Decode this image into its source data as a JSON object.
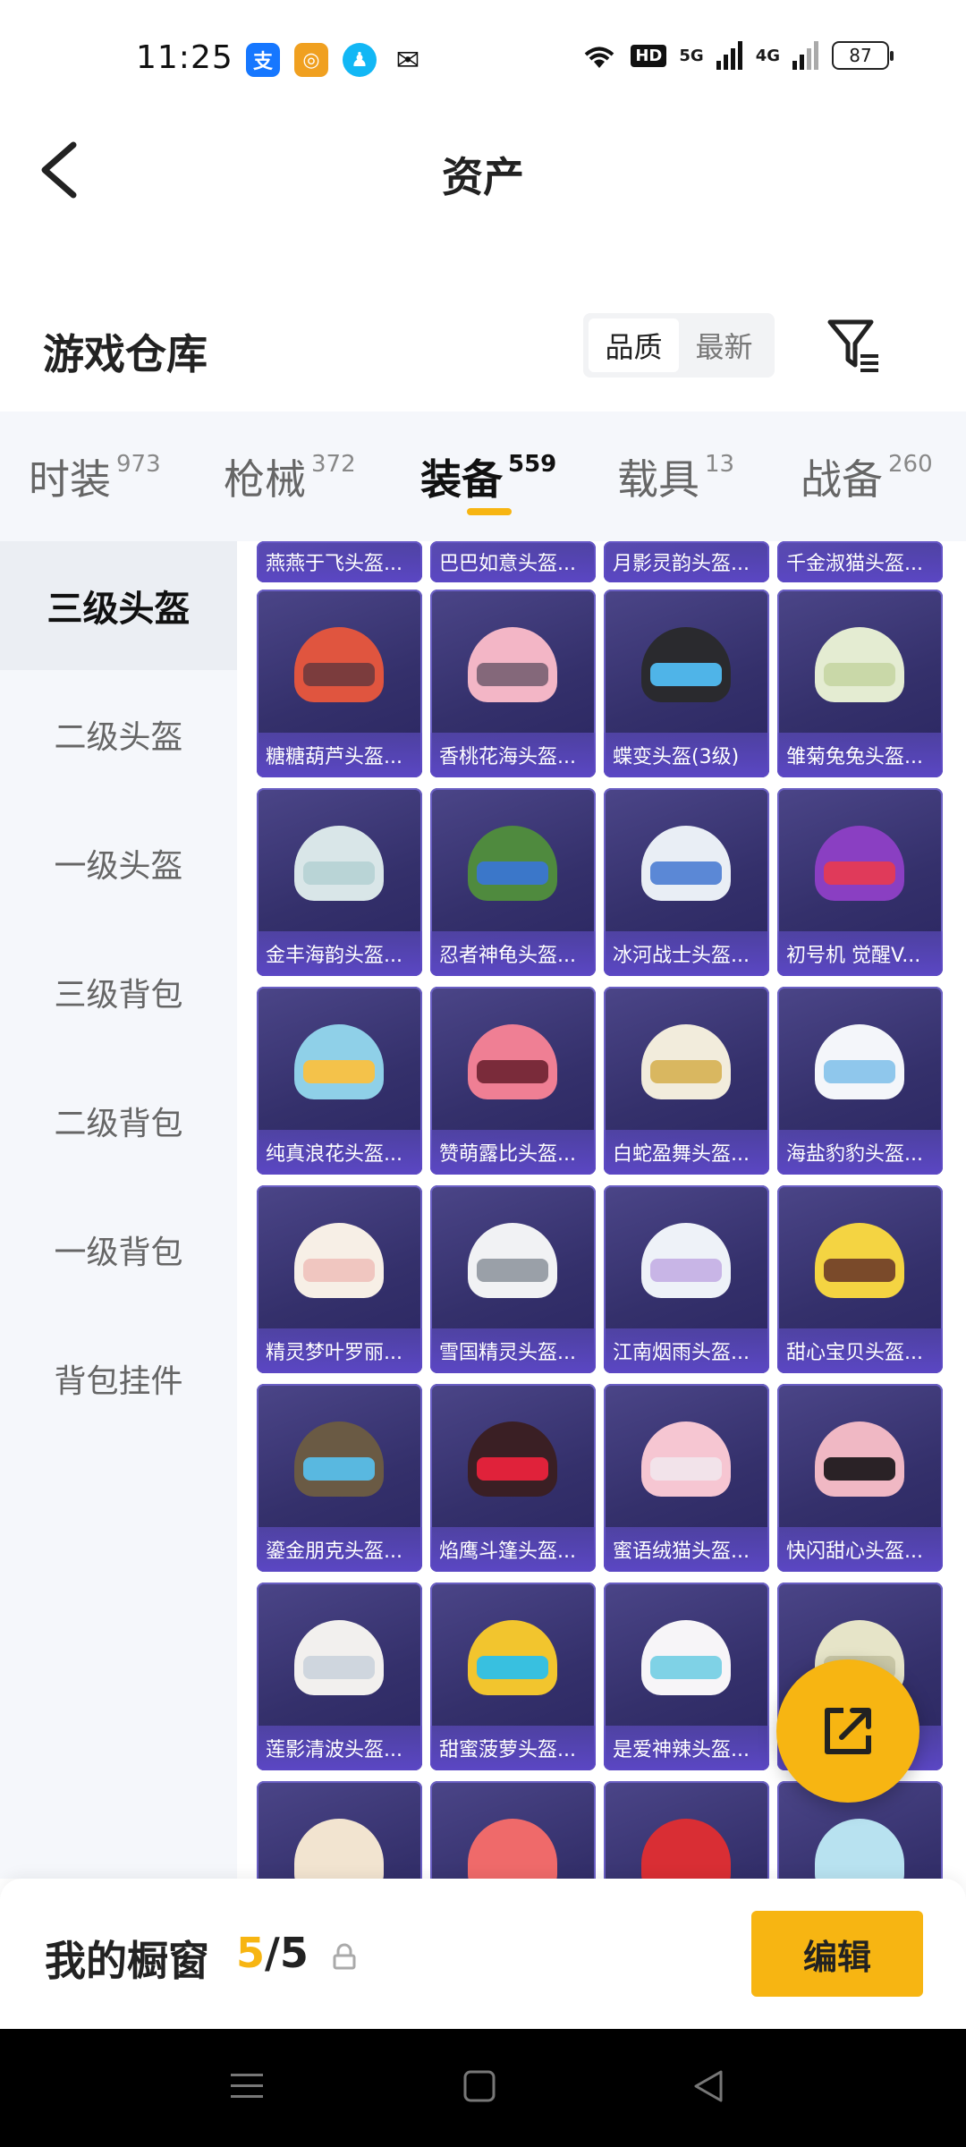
{
  "status": {
    "time": "11:25",
    "battery": "87",
    "net1": "5G",
    "net2": "4G",
    "hd": "HD"
  },
  "header": {
    "title": "资产"
  },
  "warehouse": {
    "title": "游戏仓库",
    "sort_options": [
      "品质",
      "最新"
    ],
    "sort_active": "品质"
  },
  "tabs": [
    {
      "label": "时装",
      "count": "973"
    },
    {
      "label": "枪械",
      "count": "372"
    },
    {
      "label": "装备",
      "count": "559"
    },
    {
      "label": "载具",
      "count": "13"
    },
    {
      "label": "战备",
      "count": "260"
    }
  ],
  "sidebar": [
    "三级头盔",
    "二级头盔",
    "一级头盔",
    "三级背包",
    "二级背包",
    "一级背包",
    "背包挂件"
  ],
  "partial_row": [
    "燕燕于飞头盔...",
    "巴巴如意头盔...",
    "月影灵韵头盔...",
    "千金淑猫头盔..."
  ],
  "items": [
    [
      "糖糖葫芦头盔...",
      "香桃花海头盔...",
      "蝶变头盔(3级)",
      "雏菊兔兔头盔..."
    ],
    [
      "金丰海韵头盔...",
      "忍者神龟头盔...",
      "冰河战士头盔...",
      "初号机 觉醒V..."
    ],
    [
      "纯真浪花头盔...",
      "赞萌露比头盔...",
      "白蛇盈舞头盔...",
      "海盐豹豹头盔..."
    ],
    [
      "精灵梦叶罗丽...",
      "雪国精灵头盔...",
      "江南烟雨头盔...",
      "甜心宝贝头盔..."
    ],
    [
      "鎏金朋克头盔...",
      "焰鹰斗篷头盔...",
      "蜜语绒猫头盔...",
      "快闪甜心头盔..."
    ],
    [
      "莲影清波头盔...",
      "甜蜜菠萝头盔...",
      "是爱神辣头盔...",
      ""
    ]
  ],
  "showcase": {
    "label": "我的橱窗",
    "current": "5",
    "total": "/5",
    "edit_label": "编辑"
  }
}
